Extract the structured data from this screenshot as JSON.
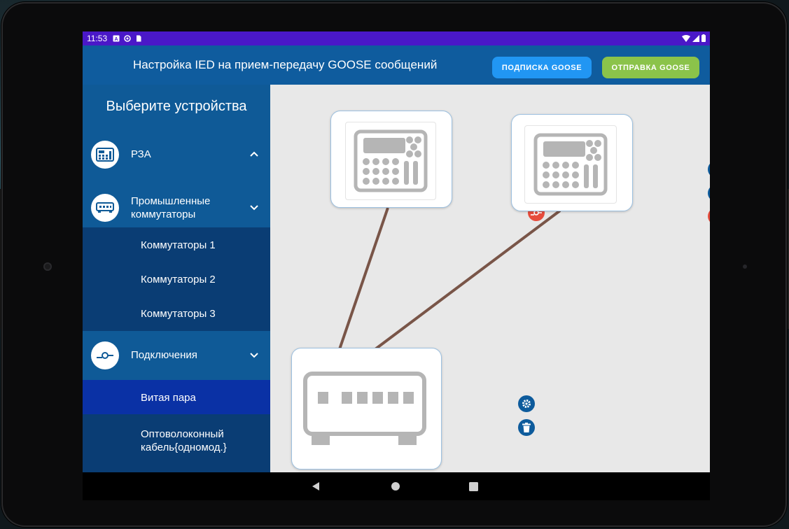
{
  "status_bar": {
    "time": "11:53"
  },
  "header": {
    "title": "Настройка IED на прием-передачу GOOSE сообщений",
    "subscribe_label": "подписка GOOSE",
    "send_label": "отправка GOOSE",
    "colors": {
      "appbar": "#0f5c9e",
      "subscribe": "#2196f3",
      "send": "#8bc34a",
      "status": "#4a18c8"
    }
  },
  "sidebar": {
    "title": "Выберите устройства",
    "categories": [
      {
        "label": "РЗА",
        "icon": "relay-icon",
        "expanded": false
      },
      {
        "label": "Промышленные коммутаторы",
        "icon": "switch-icon",
        "expanded": true,
        "items": [
          "Коммутаторы 1",
          "Коммутаторы 2",
          "Коммутаторы 3"
        ]
      },
      {
        "label": "Подключения",
        "icon": "connection-icon",
        "expanded": true,
        "items": [
          "Витая пара",
          "Оптоволоконный кабель{одномод.}"
        ]
      }
    ],
    "selected": "Витая пара"
  },
  "canvas": {
    "devices": [
      {
        "type": "relay",
        "icon": "relay-device-icon",
        "controls": [
          "gear-icon",
          "trash-icon",
          "connect-icon"
        ]
      },
      {
        "type": "relay",
        "icon": "relay-device-icon",
        "controls": [
          "gear-icon",
          "trash-icon",
          "connect-icon"
        ]
      },
      {
        "type": "switch",
        "icon": "switch-device-icon",
        "controls": [
          "gear-icon",
          "trash-icon"
        ]
      }
    ],
    "links": [
      {
        "from": 0,
        "to": 2,
        "type": "twisted-pair"
      },
      {
        "from": 1,
        "to": 2,
        "type": "twisted-pair"
      }
    ],
    "link_color": "#795548"
  },
  "navbar": {
    "icons": [
      "back-icon",
      "home-icon",
      "recents-icon"
    ]
  }
}
